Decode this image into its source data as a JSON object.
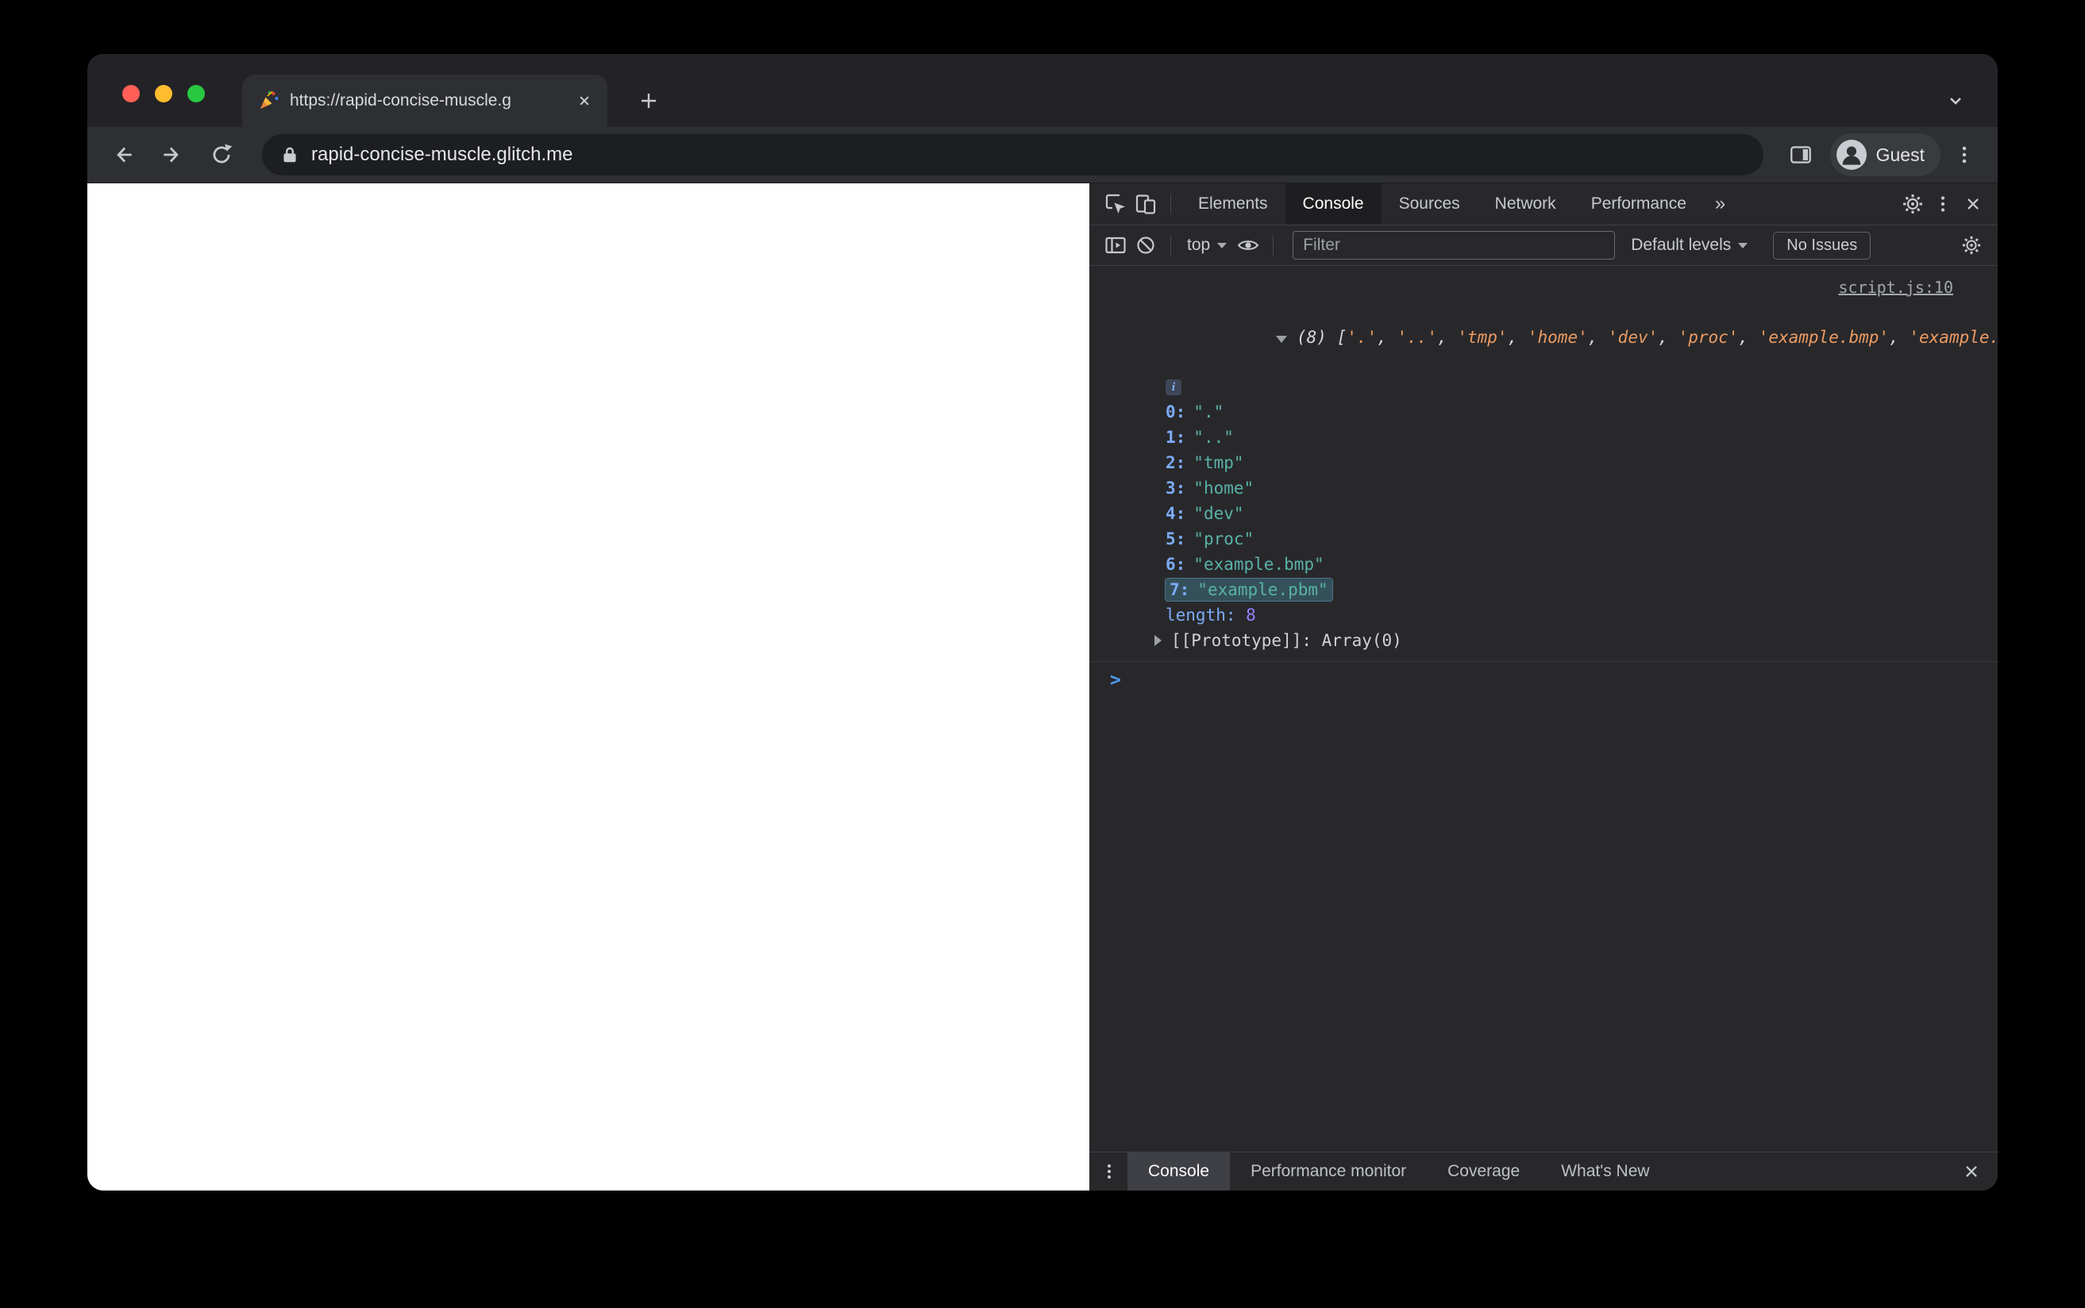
{
  "window": {
    "tab_title": "https://rapid-concise-muscle.g",
    "url": "rapid-concise-muscle.glitch.me",
    "profile": "Guest"
  },
  "devtools": {
    "tabs": [
      "Elements",
      "Console",
      "Sources",
      "Network",
      "Performance"
    ],
    "tabs_more": "»",
    "toolbar": {
      "context": "top",
      "filter_placeholder": "Filter",
      "levels": "Default levels",
      "issues": "No Issues"
    },
    "console": {
      "source_link": "script.js:10",
      "preview": {
        "count": "(8) ",
        "open": "[",
        "close": "]",
        "sep": ", ",
        "items": [
          "'.'",
          "'..'",
          "'tmp'",
          "'home'",
          "'dev'",
          "'proc'",
          "'example.bmp'",
          "'example.pbm'"
        ]
      },
      "info_badge": "i",
      "rows": [
        {
          "k": "0:",
          "v": "\".\""
        },
        {
          "k": "1:",
          "v": "\"..\""
        },
        {
          "k": "2:",
          "v": "\"tmp\""
        },
        {
          "k": "3:",
          "v": "\"home\""
        },
        {
          "k": "4:",
          "v": "\"dev\""
        },
        {
          "k": "5:",
          "v": "\"proc\""
        },
        {
          "k": "6:",
          "v": "\"example.bmp\""
        },
        {
          "k": "7:",
          "v": "\"example.pbm\""
        }
      ],
      "length_label": "length: ",
      "length_value": "8",
      "prototype_label": "[[Prototype]]: ",
      "prototype_value": "Array(0)",
      "prompt": ">"
    },
    "drawer": [
      "Console",
      "Performance monitor",
      "Coverage",
      "What's New"
    ]
  },
  "colors": {
    "index_blue": "#7cacf8",
    "string_teal": "#59b2a8",
    "preview_orange": "#ec9b62",
    "number_purple": "#9980ff",
    "prompt_blue": "#4e9bf5",
    "traffic_red": "#ff5f57",
    "traffic_yellow": "#febc2e",
    "traffic_green": "#28c840"
  }
}
